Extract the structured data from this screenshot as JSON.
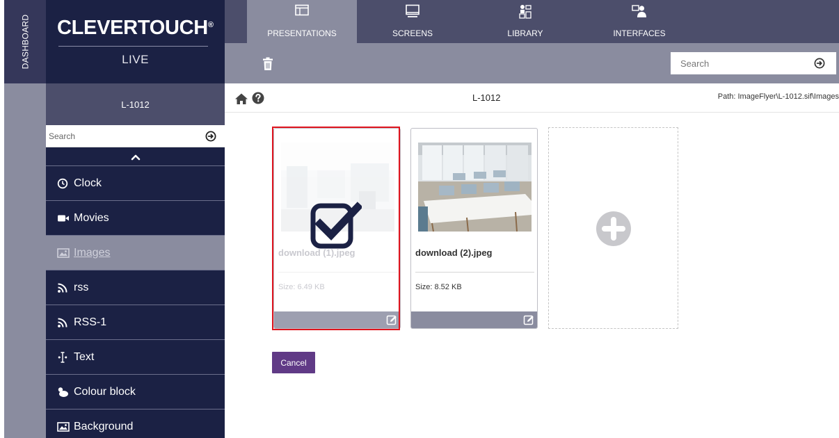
{
  "dashboard": {
    "label": "DASHBOARD"
  },
  "brand": {
    "name": "CLEVERTOUCH",
    "registered": "®",
    "sub": "LIVE"
  },
  "nav": {
    "tabs": [
      {
        "label": "PRESENTATIONS",
        "icon": "presentation-icon",
        "active": true
      },
      {
        "label": "SCREENS",
        "icon": "monitor-icon",
        "active": false
      },
      {
        "label": "LIBRARY",
        "icon": "library-icon",
        "active": false
      },
      {
        "label": "INTERFACES",
        "icon": "interfaces-icon",
        "active": false
      }
    ]
  },
  "toolbar": {
    "search_placeholder": "Search"
  },
  "sidebar": {
    "presentation": "L-1012",
    "search_placeholder": "Search",
    "items": [
      {
        "label": "Clock",
        "icon": "clock-icon"
      },
      {
        "label": "Movies",
        "icon": "video-camera-icon"
      },
      {
        "label": "Images",
        "icon": "image-icon",
        "active": true
      },
      {
        "label": "rss",
        "icon": "rss-icon"
      },
      {
        "label": "RSS-1",
        "icon": "rss-icon"
      },
      {
        "label": "Text",
        "icon": "text-cursor-icon"
      },
      {
        "label": "Colour block",
        "icon": "paint-bucket-icon"
      },
      {
        "label": "Background",
        "icon": "image-icon"
      }
    ]
  },
  "content": {
    "title": "L-1012",
    "path": "Path: ImageFlyer\\L-1012.sif\\Images",
    "files": [
      {
        "name": "download (1).jpeg",
        "size": "Size: 6.49 KB",
        "selected": true
      },
      {
        "name": "download (2).jpeg",
        "size": "Size: 8.52 KB",
        "selected": false
      }
    ],
    "cancel_label": "Cancel"
  },
  "colors": {
    "sidebar_bg": "#1b2144",
    "nav_bg": "#4c4e6b",
    "active_grey": "#8a8c9f",
    "cancel_purple": "#603a86",
    "selection_red": "#e0141e"
  }
}
